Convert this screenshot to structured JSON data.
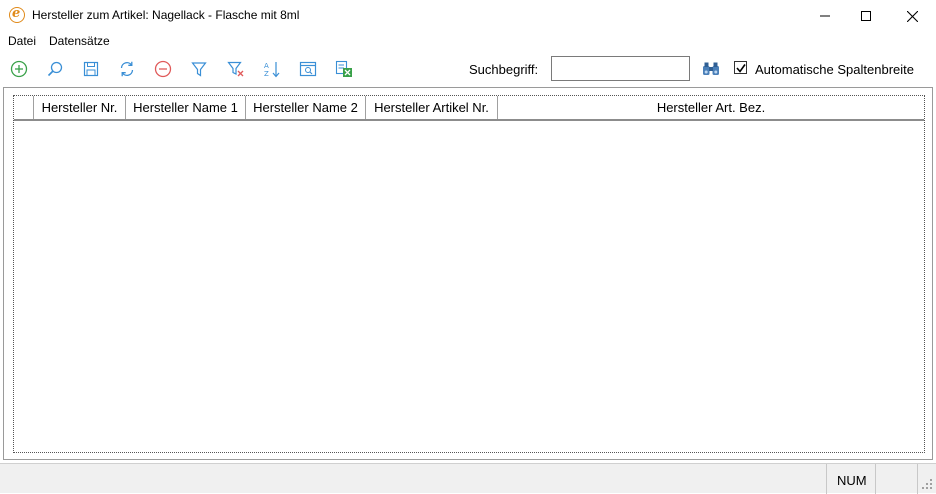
{
  "window": {
    "title": "Hersteller zum Artikel: Nagellack - Flasche mit 8ml",
    "app_icon_glyph": "e"
  },
  "menu": {
    "items": [
      {
        "label": "Datei"
      },
      {
        "label": "Datensätze"
      }
    ]
  },
  "toolbar": {
    "icons": [
      "add-icon",
      "search-icon",
      "save-icon",
      "refresh-icon",
      "delete-icon",
      "filter-icon",
      "clear-filter-icon",
      "sort-icon",
      "preview-icon",
      "excel-export-icon"
    ],
    "search_label": "Suchbegriff:",
    "search_value": "",
    "find_icon": "binoculars-icon",
    "auto_width_label": "Automatische Spaltenbreite",
    "auto_width_checked": true
  },
  "grid": {
    "columns": [
      {
        "label": ""
      },
      {
        "label": "Hersteller Nr."
      },
      {
        "label": "Hersteller Name 1"
      },
      {
        "label": "Hersteller Name 2"
      },
      {
        "label": "Hersteller Artikel Nr."
      },
      {
        "label": "Hersteller Art. Bez."
      }
    ],
    "rows": []
  },
  "statusbar": {
    "num": "NUM"
  },
  "colors": {
    "icon_green": "#3aa14a",
    "icon_blue": "#3a8fd6",
    "icon_red": "#e05a5a",
    "app_orange": "#e08a1a"
  }
}
